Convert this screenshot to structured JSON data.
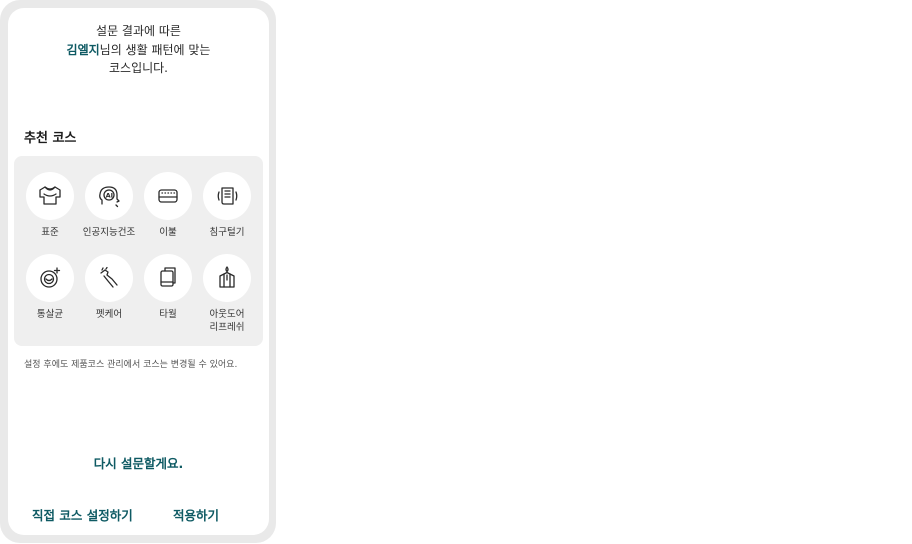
{
  "intro": {
    "line1": "설문 결과에 따른",
    "name": "김엘지",
    "line2_suffix": "님의 생활 패턴에 맞는",
    "line3": "코스입니다."
  },
  "section_title": "추천 코스",
  "courses": [
    {
      "label": "표준",
      "icon": "shirt-icon"
    },
    {
      "label": "인공지능건조",
      "icon": "ai-head-icon"
    },
    {
      "label": "이불",
      "icon": "blanket-icon"
    },
    {
      "label": "침구털기",
      "icon": "bedding-shake-icon"
    },
    {
      "label": "통살균",
      "icon": "drum-sterilize-icon"
    },
    {
      "label": "펫케어",
      "icon": "pet-care-icon"
    },
    {
      "label": "타월",
      "icon": "towel-icon"
    },
    {
      "label": "아웃도어\n리프레쉬",
      "icon": "outdoor-refresh-icon"
    }
  ],
  "note": "설정 후에도 제품코스 관리에서 코스는 변경될 수 있어요.",
  "resurvey_label": "다시 설문할게요.",
  "bottom": {
    "manual_label": "직접 코스 설정하기",
    "apply_label": "적용하기"
  },
  "colors": {
    "accent": "#0e5a63",
    "box_bg": "#efefef",
    "frame": "#e9e9e9"
  }
}
